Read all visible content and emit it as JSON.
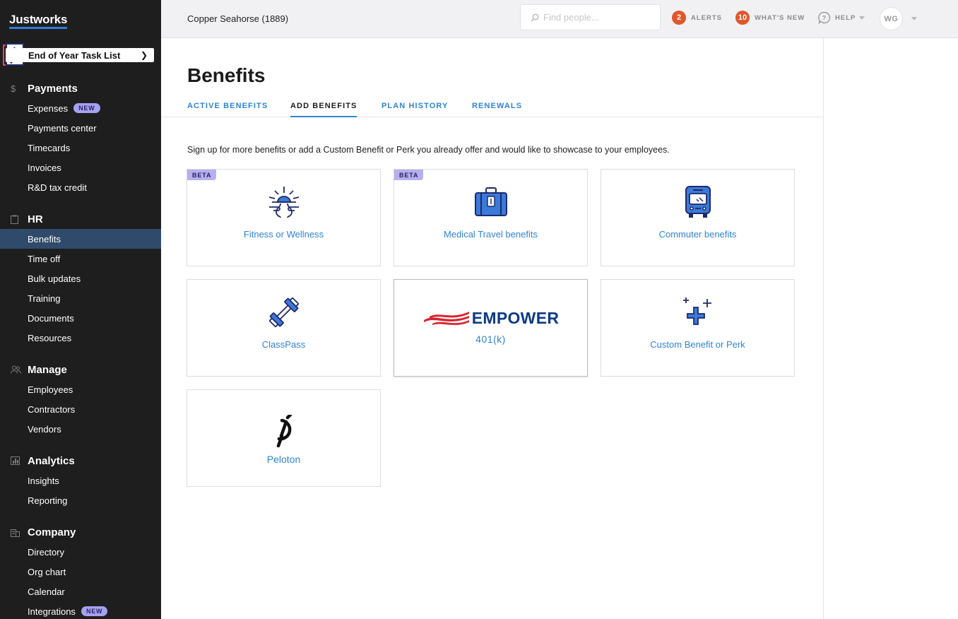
{
  "sidebar": {
    "logo": "Justworks",
    "task_list": "End of Year Task List",
    "sections": [
      {
        "title": "Payments",
        "icon": "dollar-icon",
        "items": [
          {
            "label": "Expenses",
            "badge": "NEW"
          },
          {
            "label": "Payments center"
          },
          {
            "label": "Timecards"
          },
          {
            "label": "Invoices"
          },
          {
            "label": "R&D tax credit"
          }
        ]
      },
      {
        "title": "HR",
        "icon": "clipboard-icon",
        "items": [
          {
            "label": "Benefits",
            "active": true
          },
          {
            "label": "Time off"
          },
          {
            "label": "Bulk updates"
          },
          {
            "label": "Training"
          },
          {
            "label": "Documents"
          },
          {
            "label": "Resources"
          }
        ]
      },
      {
        "title": "Manage",
        "icon": "people-icon",
        "items": [
          {
            "label": "Employees"
          },
          {
            "label": "Contractors"
          },
          {
            "label": "Vendors"
          }
        ]
      },
      {
        "title": "Analytics",
        "icon": "bar-chart-icon",
        "items": [
          {
            "label": "Insights"
          },
          {
            "label": "Reporting"
          }
        ]
      },
      {
        "title": "Company",
        "icon": "building-icon",
        "items": [
          {
            "label": "Directory"
          },
          {
            "label": "Org chart"
          },
          {
            "label": "Calendar"
          },
          {
            "label": "Integrations",
            "badge": "NEW"
          }
        ]
      }
    ]
  },
  "topbar": {
    "company": "Copper Seahorse (1889)",
    "search_placeholder": "Find people...",
    "alerts_count": "2",
    "alerts_label": "ALERTS",
    "whats_new_count": "10",
    "whats_new_label": "WHAT'S NEW",
    "help_label": "HELP",
    "avatar_initials": "WG"
  },
  "page": {
    "title": "Benefits",
    "tabs": [
      {
        "label": "ACTIVE BENEFITS",
        "active": false
      },
      {
        "label": "ADD BENEFITS",
        "active": true
      },
      {
        "label": "PLAN HISTORY",
        "active": false
      },
      {
        "label": "RENEWALS",
        "active": false
      }
    ],
    "intro": "Sign up for more benefits or add a Custom Benefit or Perk you already offer and would like to showcase to your employees.",
    "cards": [
      {
        "label": "Fitness or Wellness",
        "badge": "BETA",
        "icon": "sunrise-wellness-icon"
      },
      {
        "label": "Medical Travel benefits",
        "badge": "BETA",
        "icon": "suitcase-icon"
      },
      {
        "label": "Commuter benefits",
        "icon": "bus-icon"
      },
      {
        "label": "ClassPass",
        "icon": "dumbbell-icon"
      },
      {
        "label": "401(k)",
        "logo_text": "EMPOWER",
        "icon": "empower-logo"
      },
      {
        "label": "Custom Benefit or Perk",
        "icon": "sparkle-plus-icon"
      },
      {
        "label": "Peloton",
        "icon": "peloton-logo"
      }
    ]
  },
  "colors": {
    "sidebar_bg": "#1e1e1e",
    "sidebar_active": "#2f4a6b",
    "accent_blue": "#2f84d6",
    "alert_orange": "#e0572c",
    "badge_purple": "#a7a1f2"
  }
}
